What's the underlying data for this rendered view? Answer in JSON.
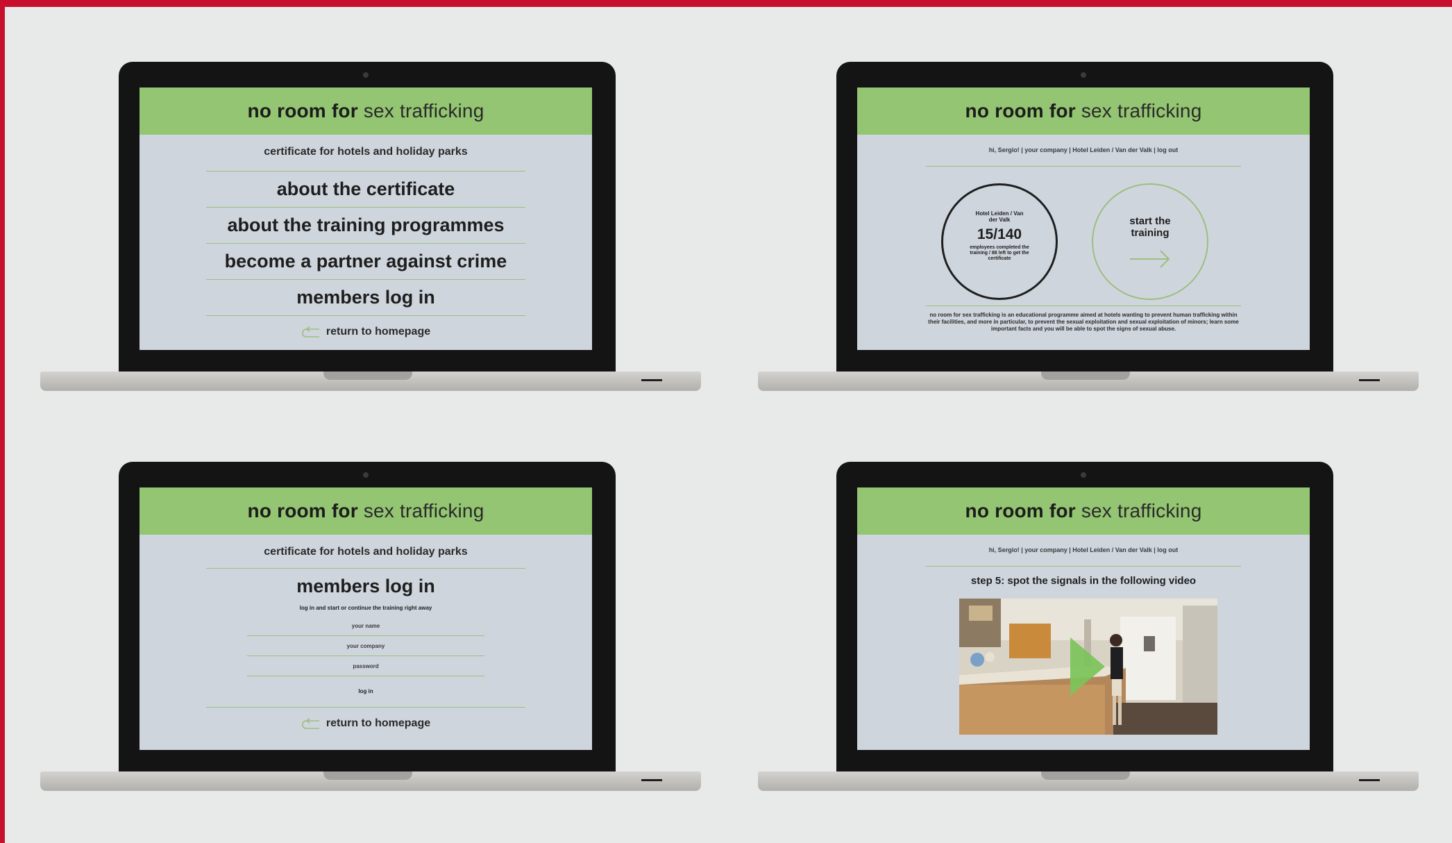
{
  "brand": {
    "strong": "no room for",
    "light": "sex trafficking"
  },
  "colors": {
    "accent_green": "#93c572",
    "screen_bg": "#cfd5dd",
    "frame_red": "#c8102e"
  },
  "home": {
    "subtitle": "certificate for hotels and holiday parks",
    "menu": [
      "about the certificate",
      "about the training programmes",
      "become a partner against crime",
      "members log in"
    ],
    "return_label": "return to homepage"
  },
  "dashboard": {
    "userbar": "hi, Sergio! | your company | Hotel Leiden / Van der Valk | log out",
    "hotel": "Hotel Leiden / Van der Valk",
    "progress": "15/140",
    "progress_caption": "employees completed the training / 88 left to get the certificate",
    "start_label": "start the training",
    "blurb": "no room for sex trafficking is an educational programme aimed at hotels wanting to prevent human trafficking within their facilities, and more in particular, to prevent the sexual exploitation and sexual exploitation of minors; learn some important facts and you will be able to spot the signs of sexual abuse."
  },
  "login": {
    "subtitle": "certificate for hotels and holiday parks",
    "title": "members log in",
    "hint": "log in and start or continue the training right away",
    "fields": [
      "your name",
      "your company",
      "password"
    ],
    "button": "log in",
    "return_label": "return to homepage"
  },
  "video_page": {
    "userbar": "hi, Sergio! | your company | Hotel Leiden / Van der Valk | log out",
    "step": "step 5: spot the signals in the following video"
  },
  "icons": {
    "return": "return-arrow-icon",
    "arrow": "right-arrow-icon",
    "play": "play-icon"
  }
}
